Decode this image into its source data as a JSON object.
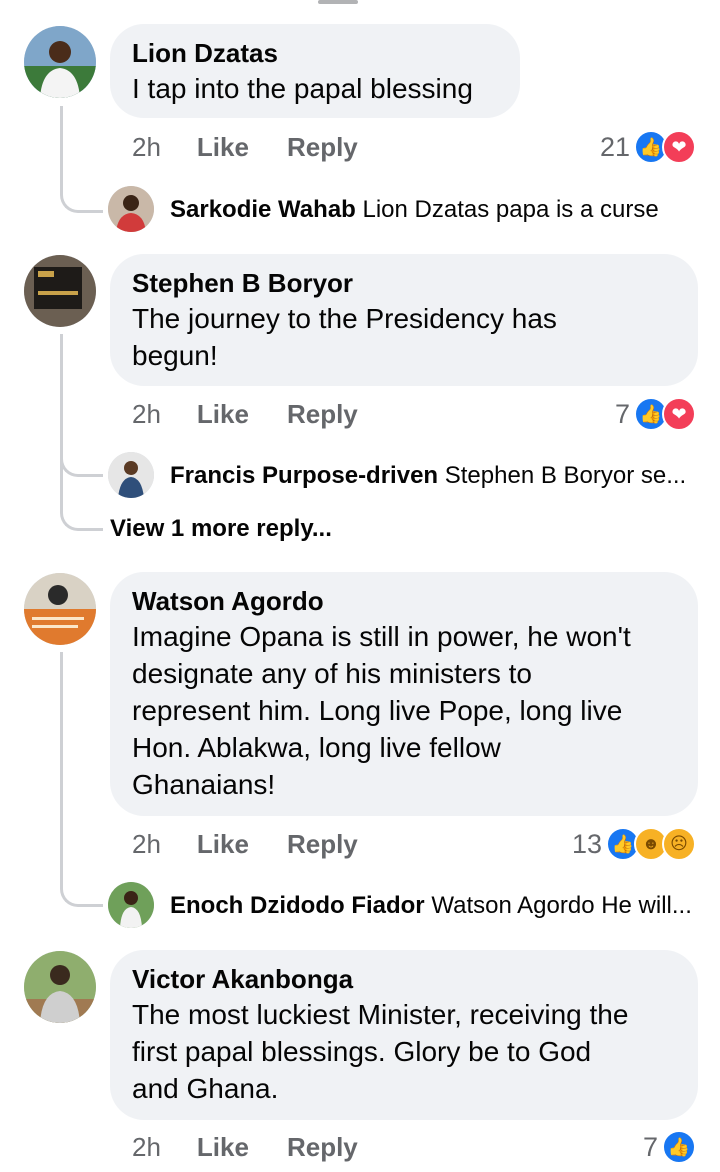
{
  "comments": [
    {
      "author": "Lion Dzatas",
      "text": "I tap into the papal blessing",
      "time": "2h",
      "like_label": "Like",
      "reply_label": "Reply",
      "reaction_count": "21",
      "reactions": [
        "like-icon",
        "love-icon"
      ],
      "replies": [
        {
          "author": "Sarkodie Wahab",
          "text": "Lion Dzatas papa is a curse"
        }
      ]
    },
    {
      "author": "Stephen B Boryor",
      "text_lines": [
        "The journey to the Presidency has",
        "begun!"
      ],
      "time": "2h",
      "like_label": "Like",
      "reply_label": "Reply",
      "reaction_count": "7",
      "reactions": [
        "like-icon",
        "love-icon"
      ],
      "replies": [
        {
          "author": "Francis Purpose-driven",
          "text": "Stephen B Boryor se..."
        }
      ],
      "view_more": "View 1 more reply..."
    },
    {
      "author": "Watson Agordo",
      "text_lines": [
        "Imagine Opana is still in power, he won't",
        "designate any of his ministers to",
        "represent him. Long live Pope, long live",
        "Hon. Ablakwa, long live fellow",
        "Ghanaians!"
      ],
      "time": "2h",
      "like_label": "Like",
      "reply_label": "Reply",
      "reaction_count": "13",
      "reactions": [
        "like-icon",
        "haha-icon",
        "sad-icon"
      ],
      "replies": [
        {
          "author": "Enoch Dzidodo Fiador",
          "text": "Watson Agordo He will..."
        }
      ]
    },
    {
      "author": "Victor Akanbonga",
      "text_lines": [
        "The most luckiest Minister, receiving the",
        "first papal blessings. Glory be to God",
        "and Ghana."
      ],
      "time": "2h",
      "like_label": "Like",
      "reply_label": "Reply",
      "reaction_count": "7",
      "reactions": [
        "like-icon"
      ]
    }
  ],
  "colors": {
    "bubble": "#f0f2f5",
    "meta_text": "#65676b",
    "like_blue": "#1877f2",
    "love_red": "#f33e58",
    "emoji_yellow": "#f7b125"
  }
}
